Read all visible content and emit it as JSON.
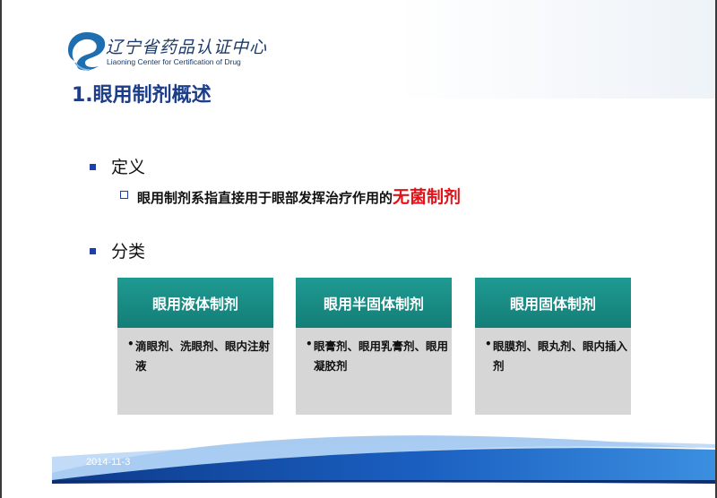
{
  "header": {
    "org_name_cn": "辽宁省药品认证中心",
    "org_name_en": "Liaoning Center for Certification of Drug"
  },
  "slide": {
    "title": "1.眼用制剂概述",
    "definition": {
      "heading": "定义",
      "text": "眼用制剂系指直接用于眼部发挥治疗作用的",
      "highlight": "无菌制剂"
    },
    "classification": {
      "heading": "分类",
      "cards": [
        {
          "title": "眼用液体制剂",
          "items": "滴眼剂、洗眼剂、眼内注射液"
        },
        {
          "title": "眼用半固体制剂",
          "items": "眼膏剂、眼用乳膏剂、眼用凝胶剂"
        },
        {
          "title": "眼用固体制剂",
          "items": "眼膜剂、眼丸剂、眼内插入剂"
        }
      ]
    }
  },
  "footer": {
    "date": "2014-11-3"
  },
  "colors": {
    "title": "#1b3d8a",
    "accent_red": "#e0141a",
    "card_header": "#168a83",
    "card_body": "#d6d6d6",
    "bullet": "#1f3fa8"
  }
}
